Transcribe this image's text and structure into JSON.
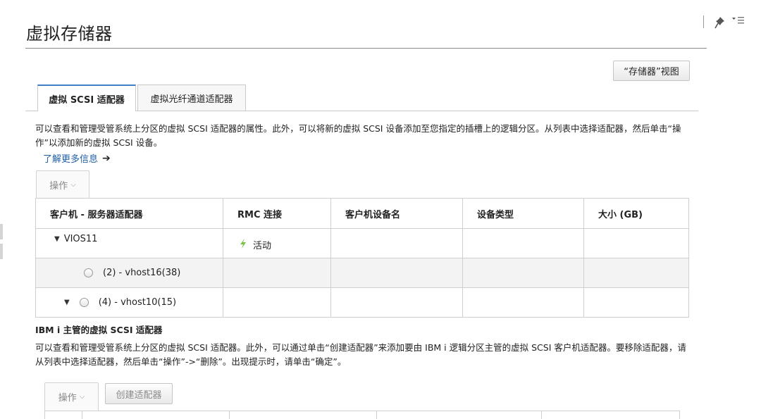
{
  "page": {
    "title": "虚拟存储器",
    "storage_view_button": "“存储器”视图",
    "top_icons": [
      "pin-icon",
      "view-menu-icon"
    ]
  },
  "tabs": [
    {
      "label": "虚拟 SCSI 适配器",
      "active": true
    },
    {
      "label": "虚拟光纤通道适配器",
      "active": false
    }
  ],
  "scsi_section": {
    "description": "可以查看和管理受管系统上分区的虚拟 SCSI 适配器的属性。此外，可以将新的虚拟 SCSI 设备添加至您指定的插槽上的逻辑分区。从列表中选择适配器，然后单击“操作”以添加新的虚拟 SCSI 设备。",
    "learn_more": "了解更多信息",
    "actions_label": "操作",
    "table": {
      "columns": [
        "客户机 - 服务器适配器",
        "RMC 连接",
        "客户机设备名",
        "设备类型",
        "大小 (GB)"
      ],
      "rows": [
        {
          "name": "VIOS11",
          "rmc": "活动",
          "client_device": "",
          "device_type": "",
          "size": "",
          "expanded": true
        },
        {
          "name": "(2) - vhost16(38)",
          "rmc": "",
          "client_device": "",
          "device_type": "",
          "size": ""
        },
        {
          "name": "(4) - vhost10(15)",
          "rmc": "",
          "client_device": "",
          "device_type": "",
          "size": "",
          "expanded": true
        }
      ]
    }
  },
  "ibmi_section": {
    "title": "IBM i 主管的虚拟 SCSI 适配器",
    "description": "可以查看和管理受管系统上分区的虚拟 SCSI 适配器。此外，可以通过单击“创建适配器”来添加要由 IBM i 逻辑分区主管的虚拟 SCSI 客户机适配器。要移除适配器，请从列表中选择适配器，然后单击“操作”->“删除”。出现提示时，请单击“确定”。",
    "actions_label": "操作",
    "create_adapter_button": "创建适配器"
  },
  "colors": {
    "active_tab_accent": "#3d7fc4",
    "link": "#1f5fa8",
    "rmc_active_icon": "#7bc144"
  }
}
